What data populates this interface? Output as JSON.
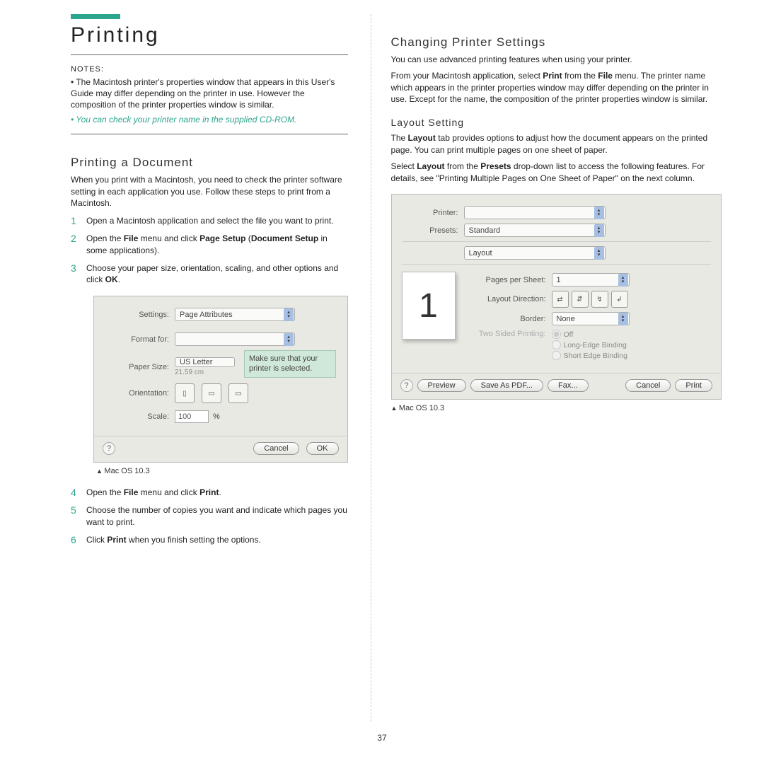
{
  "left": {
    "title": "Printing",
    "notes_label": "NOTES:",
    "note1": "The Macintosh printer's properties window that appears in this User's Guide may differ depending on the printer in use. However the composition of the printer properties window is similar.",
    "note2": "You can check your printer name in the supplied CD-ROM.",
    "subhead": "Printing a Document",
    "intro": "When you print with a Macintosh, you need to check the printer software setting in each application you use. Follow these steps to print from a Macintosh.",
    "steps": [
      "Open a Macintosh application and select the file you want to print.",
      "Open the File menu and click Page Setup (Document Setup in some applications).",
      "Choose your paper size, orientation, scaling, and other options and click OK."
    ],
    "dialog1": {
      "settings_label": "Settings:",
      "settings_value": "Page Attributes",
      "format_label": "Format for:",
      "paper_label": "Paper Size:",
      "paper_value": "US Letter",
      "paper_sub": "21.59 cm",
      "orient_label": "Orientation:",
      "scale_label": "Scale:",
      "scale_value": "100",
      "scale_pct": "%",
      "callout": "Make sure that your printer is selected.",
      "cancel": "Cancel",
      "ok": "OK"
    },
    "caption1": "Mac OS 10.3",
    "steps2": [
      {
        "n": "4",
        "t": "Open the File menu and click Print."
      },
      {
        "n": "5",
        "t": "Choose the number of copies you want and indicate which pages you want to print."
      },
      {
        "n": "6",
        "t": "Click Print when you finish setting the options."
      }
    ]
  },
  "right": {
    "title": "Changing Printer Settings",
    "p1": "You can use advanced printing features when using your printer.",
    "p2": "From your Macintosh application, select Print from the File menu. The printer name which appears in the printer properties window may differ depending on the printer in use. Except for the name, the composition of the printer properties window is similar.",
    "sub": "Layout Setting",
    "p3": "The Layout tab provides options to adjust how the document appears on the printed page. You can print multiple pages on one sheet of paper.",
    "p4": "Select Layout from the Presets drop-down list to access the following features. For details, see \"Printing Multiple Pages on One Sheet of Paper\" on the next column.",
    "dialog2": {
      "printer_label": "Printer:",
      "presets_label": "Presets:",
      "presets_value": "Standard",
      "section_value": "Layout",
      "pps_label": "Pages per Sheet:",
      "pps_value": "1",
      "dir_label": "Layout Direction:",
      "border_label": "Border:",
      "border_value": "None",
      "tsp_label": "Two Sided Printing:",
      "opt_off": "Off",
      "opt_long": "Long-Edge Binding",
      "opt_short": "Short Edge Binding",
      "preview": "Preview",
      "save": "Save As PDF...",
      "fax": "Fax...",
      "cancel": "Cancel",
      "print": "Print"
    },
    "caption2": "Mac OS 10.3"
  },
  "page_number": "37"
}
